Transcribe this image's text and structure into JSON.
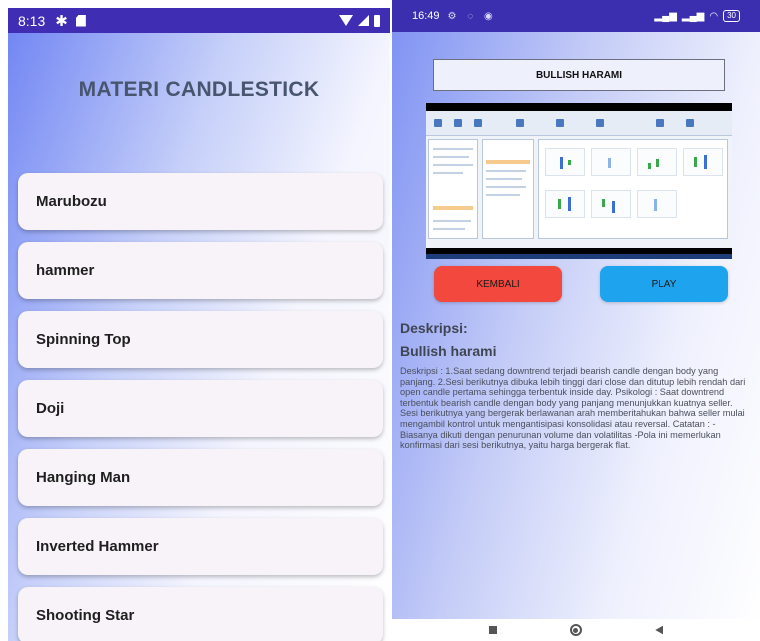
{
  "left_screen": {
    "status": {
      "time": "8:13"
    },
    "title": "MATERI CANDLESTICK",
    "menu": [
      {
        "label": "Marubozu"
      },
      {
        "label": "hammer"
      },
      {
        "label": "Spinning Top"
      },
      {
        "label": "Doji"
      },
      {
        "label": "Hanging Man"
      },
      {
        "label": "Inverted Hammer"
      },
      {
        "label": "Shooting Star"
      }
    ]
  },
  "right_screen": {
    "status": {
      "time": "16:49",
      "battery": "30"
    },
    "header_title": "BULLISH HARAMI",
    "buttons": {
      "back": "KEMBALI",
      "play": "PLAY"
    },
    "section_title": "Deskripsi:",
    "sub_title": "Bullish harami",
    "description": "Deskripsi : 1.Saat sedang downtrend terjadi bearish candle dengan body yang panjang.  2.Sesi berikutnya dibuka lebih tinggi dari close dan ditutup lebih rendah dari open candle pertama sehingga terbentuk inside day.  Psikologi : Saat downtrend terbentuk bearish candle dengan body yang panjang menunjukkan kuatnya seller. Sesi berikutnya yang bergerak berlawanan arah memberitahukan bahwa seller mulai mengambil kontrol untuk mengantisipasi konsolidasi atau reversal.  Catatan : -Biasanya dikuti dengan penurunan volume dan volatilitas -Pola ini memerlukan konfirmasi dari sesi berikutnya, yaitu harga bergerak flat."
  },
  "colors": {
    "status_bar": "#3f2db3",
    "kembali_button": "#f2483d",
    "play_button": "#1ea3ee",
    "gradient_start": "#6f84f3"
  }
}
